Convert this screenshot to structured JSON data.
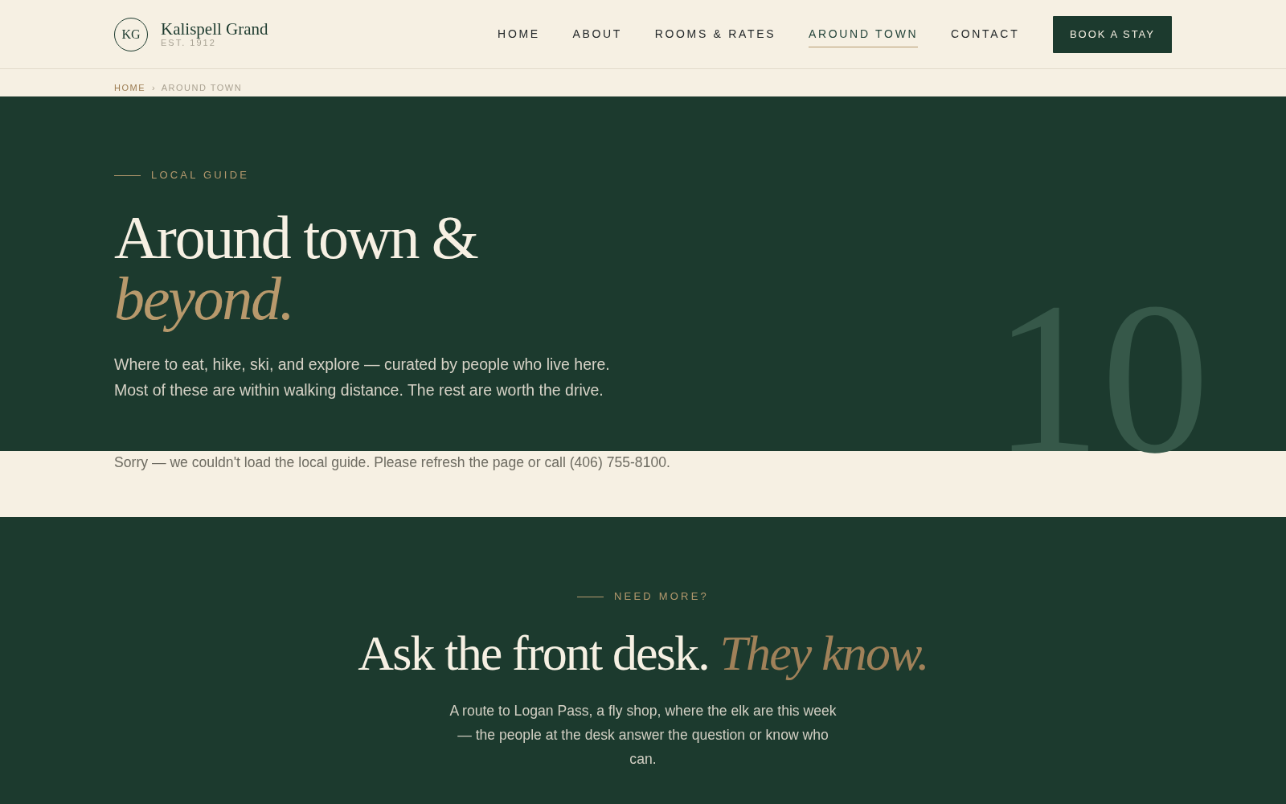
{
  "header": {
    "logo": {
      "monogram": "KG",
      "name": "Kalispell Grand",
      "tagline": "EST. 1912"
    },
    "nav": [
      {
        "label": "HOME",
        "selected": false
      },
      {
        "label": "ABOUT",
        "selected": false
      },
      {
        "label": "ROOMS & RATES",
        "selected": false
      },
      {
        "label": "AROUND TOWN",
        "selected": true
      },
      {
        "label": "CONTACT",
        "selected": false
      }
    ],
    "cta": "BOOK A STAY"
  },
  "breadcrumb": {
    "items": [
      {
        "label": "HOME",
        "current": false
      },
      {
        "label": "AROUND TOWN",
        "current": true
      }
    ],
    "separator": "›"
  },
  "hero": {
    "eyebrow": "LOCAL GUIDE",
    "title": "Around town & *beyond.*",
    "intro": "Where to eat, hike, ski, and explore — curated by people who live here. Most of these are within walking distance. The rest are worth the drive.",
    "backdrop_numeral": "10"
  },
  "error_message": "Sorry — we couldn't load the local guide. Please refresh the page or call (406) 755-8100.",
  "contact": {
    "eyebrow": "NEED MORE?",
    "title": "Ask the front desk. *They know.*",
    "text": "A route to Logan Pass, a fly shop, where the elk are this week — the people at the desk answer the question or know who can."
  }
}
